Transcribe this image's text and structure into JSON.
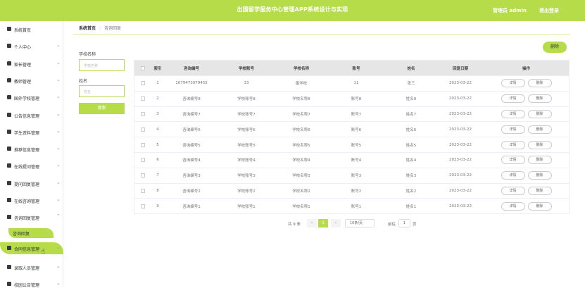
{
  "header": {
    "title": "出国留学服务中心管理APP系统设计与实现",
    "admin_label": "管理员 admin",
    "logout_label": "退出登录"
  },
  "sidebar": {
    "items": [
      {
        "label": "系统首页",
        "arrow": ""
      },
      {
        "label": "个人中心",
        "arrow": "⌄"
      },
      {
        "label": "家长管理",
        "arrow": "⌄"
      },
      {
        "label": "教师管理",
        "arrow": "⌄"
      },
      {
        "label": "国外学校管理",
        "arrow": "⌄"
      },
      {
        "label": "公告信息管理",
        "arrow": "⌄"
      },
      {
        "label": "学生资料管理",
        "arrow": "⌄"
      },
      {
        "label": "推荐信息管理",
        "arrow": "⌄"
      },
      {
        "label": "在线提问管理",
        "arrow": "⌄"
      },
      {
        "label": "提问回复管理",
        "arrow": "⌄"
      },
      {
        "label": "在线咨询管理",
        "arrow": "⌄"
      },
      {
        "label": "咨询回复管理",
        "arrow": "⌃"
      },
      {
        "label": "合同信息管理",
        "arrow": "⌄"
      },
      {
        "label": "录取人员管理",
        "arrow": "⌄"
      },
      {
        "label": "校园公告管理",
        "arrow": "⌄"
      }
    ],
    "submenu": {
      "label": "咨询回复"
    }
  },
  "breadcrumb": {
    "home": "系统首页",
    "sep": "⋮",
    "current": "咨询回复"
  },
  "search": {
    "school_label": "学校名称",
    "school_placeholder": "学校名称",
    "name_label": "姓名",
    "name_placeholder": "姓名",
    "button_label": "搜索"
  },
  "toolbar": {
    "delete_label": "删除"
  },
  "table": {
    "headers": [
      "",
      "索引",
      "咨询编号",
      "学校账号",
      "学校名称",
      "账号",
      "姓名",
      "回复日期",
      "操作"
    ],
    "rows": [
      [
        "1",
        "1679473979455",
        "33",
        "雷学校",
        "11",
        "张三",
        "2023-03-22"
      ],
      [
        "2",
        "咨询编号8",
        "学校账号8",
        "学校名称8",
        "账号8",
        "姓名8",
        "2023-03-22"
      ],
      [
        "3",
        "咨询编号7",
        "学校账号7",
        "学校名称7",
        "账号7",
        "姓名7",
        "2023-03-22"
      ],
      [
        "4",
        "咨询编号6",
        "学校账号6",
        "学校名称6",
        "账号6",
        "姓名6",
        "2023-03-22"
      ],
      [
        "5",
        "咨询编号5",
        "学校账号5",
        "学校名称5",
        "账号5",
        "姓名5",
        "2023-03-22"
      ],
      [
        "6",
        "咨询编号4",
        "学校账号4",
        "学校名称4",
        "账号4",
        "姓名4",
        "2023-03-22"
      ],
      [
        "7",
        "咨询编号3",
        "学校账号3",
        "学校名称3",
        "账号3",
        "姓名3",
        "2023-03-22"
      ],
      [
        "8",
        "咨询编号2",
        "学校账号2",
        "学校名称2",
        "账号2",
        "姓名2",
        "2023-03-22"
      ],
      [
        "9",
        "咨询编号1",
        "学校账号1",
        "学校名称1",
        "账号1",
        "姓名1",
        "2023-03-22"
      ]
    ],
    "detail_label": "详情",
    "delete_label": "删除"
  },
  "pagination": {
    "total": "共 9 条",
    "prev": "‹",
    "current_page": "1",
    "next": "›",
    "page_size": "10条/页",
    "goto_label": "前往",
    "goto_value": "1",
    "page_word": "页"
  },
  "colors": {
    "accent": "#b6dc4a",
    "header_bg": "#e6e6e6"
  }
}
